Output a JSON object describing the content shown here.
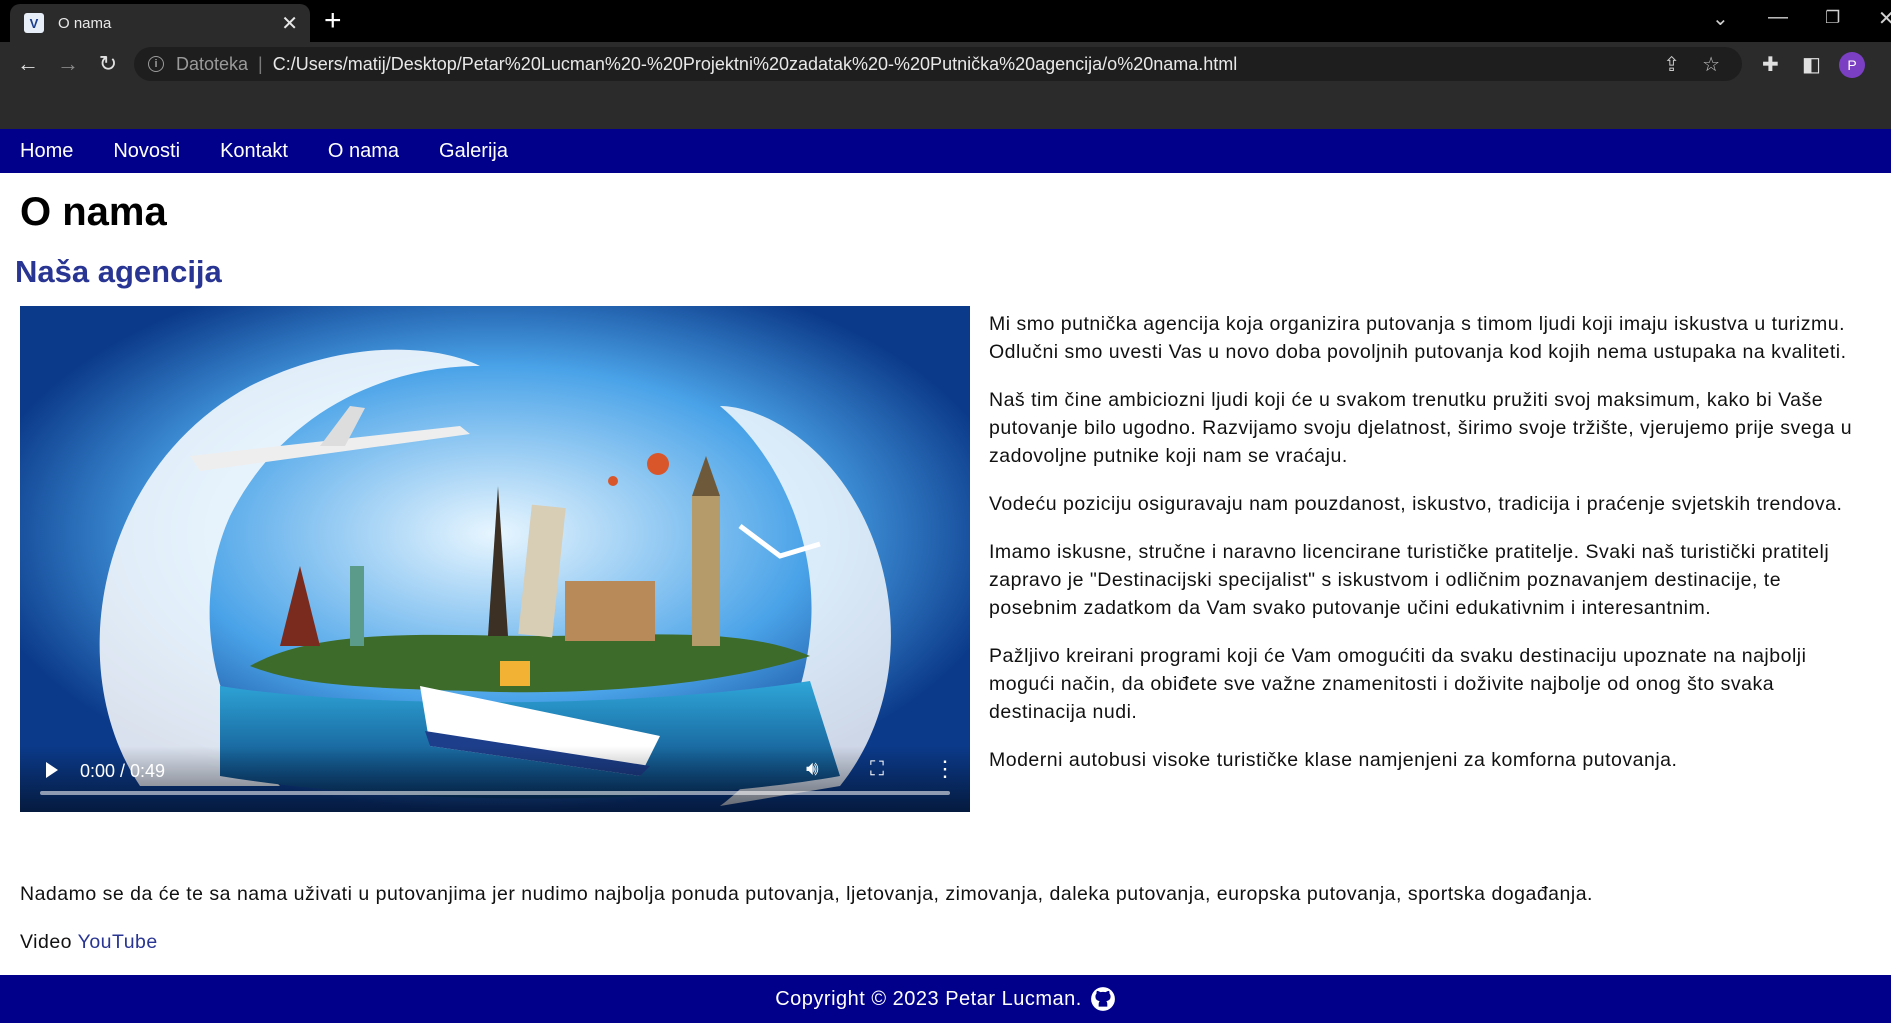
{
  "browser": {
    "tab_title": "O nama",
    "tab_favicon": "V",
    "scheme_label": "Datoteka",
    "url": "C:/Users/matij/Desktop/Petar%20Lucman%20-%20Projektni%20zadatak%20-%20Putnička%20agencija/o%20nama.html",
    "profile_initial": "P"
  },
  "nav": {
    "items": [
      {
        "label": "Home"
      },
      {
        "label": "Novosti"
      },
      {
        "label": "Kontakt"
      },
      {
        "label": "O nama"
      },
      {
        "label": "Galerija"
      }
    ]
  },
  "page": {
    "title": "O nama",
    "subtitle": "Naša agencija",
    "video": {
      "time": "0:00 / 0:49",
      "progress": 0
    },
    "paragraphs": [
      "Mi smo putnička agencija koja organizira putovanja s timom ljudi koji imaju iskustva u turizmu. Odlučni smo uvesti Vas u novo doba povoljnih putovanja kod kojih nema ustupaka na kvaliteti.",
      "Naš tim čine ambiciozni ljudi koji će u svakom trenutku pružiti svoj maksimum, kako bi Vaše putovanje bilo ugodno. Razvijamo svoju djelatnost, širimo svoje tržište, vjerujemo prije svega u zadovoljne putnike koji nam se vraćaju.",
      "Vodeću poziciju osiguravaju nam pouzdanost, iskustvo, tradicija i praćenje svjetskih trendova.",
      "Imamo iskusne, stručne i naravno licencirane turističke pratitelje. Svaki naš turistički pratitelj zapravo je \"Destinacijski specijalist\" s iskustvom i odličnim poznavanjem destinacije, te posebnim zadatkom da Vam svako putovanje učini edukativnim i interesantnim.",
      "Pažljivo kreirani programi koji će Vam omogućiti da svaku destinaciju upoznate na najbolji mogući način, da obiđete sve važne znamenitosti i doživite najbolje od onog što svaka destinacija nudi.",
      "Moderni autobusi visoke turističke klase namjenjeni za komforna putovanja."
    ],
    "closing": "Nadamo se da će te sa nama uživati u putovanjima jer nudimo najbolja ponuda putovanja, ljetovanja, zimovanja, daleka putovanja, europska putovanja, sportska događanja.",
    "video_label": "Video",
    "video_link": "YouTube"
  },
  "footer": {
    "text": "Copyright © 2023 Petar Lucman."
  }
}
